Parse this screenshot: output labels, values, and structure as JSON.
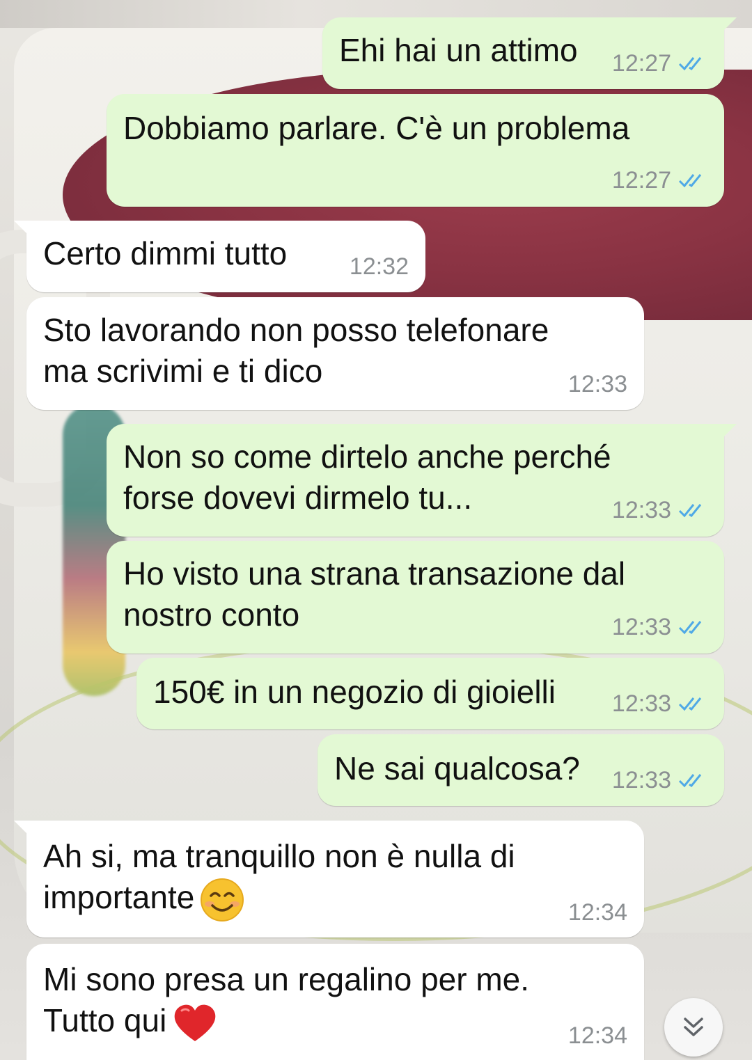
{
  "messages": [
    {
      "direction": "out",
      "text": "Ehi hai un attimo",
      "time": "12:27",
      "read": true
    },
    {
      "direction": "out",
      "text": "Dobbiamo parlare. C'è un problema",
      "time": "12:27",
      "read": true
    },
    {
      "direction": "in",
      "text": "Certo dimmi tutto",
      "time": "12:32"
    },
    {
      "direction": "in",
      "text": "Sto lavorando non posso telefonare\nma scrivimi e ti dico",
      "time": "12:33"
    },
    {
      "direction": "out",
      "text": "Non so come dirtelo anche perché\nforse dovevi dirmelo tu...",
      "time": "12:33",
      "read": true
    },
    {
      "direction": "out",
      "text": "Ho visto una strana transazione dal\nnostro conto",
      "time": "12:33",
      "read": true
    },
    {
      "direction": "out",
      "text": "150€ in un negozio di gioielli",
      "time": "12:33",
      "read": true
    },
    {
      "direction": "out",
      "text": "Ne sai qualcosa?",
      "time": "12:33",
      "read": true
    },
    {
      "direction": "in",
      "text": "Ah si, ma tranquillo non è nulla di\nimportante",
      "time": "12:34",
      "emoji": "smiling-face"
    },
    {
      "direction": "in",
      "text": "Mi sono presa un regalino per me.\nTutto qui",
      "time": "12:34",
      "emoji": "red-heart"
    }
  ],
  "colors": {
    "outgoing_bubble": "#e3f9d4",
    "incoming_bubble": "#ffffff",
    "read_ticks": "#4fa9e6",
    "timestamp": "#8b8f92"
  },
  "icons": {
    "read_receipt": "double-check-icon",
    "scroll_down": "double-chevron-down-icon"
  }
}
